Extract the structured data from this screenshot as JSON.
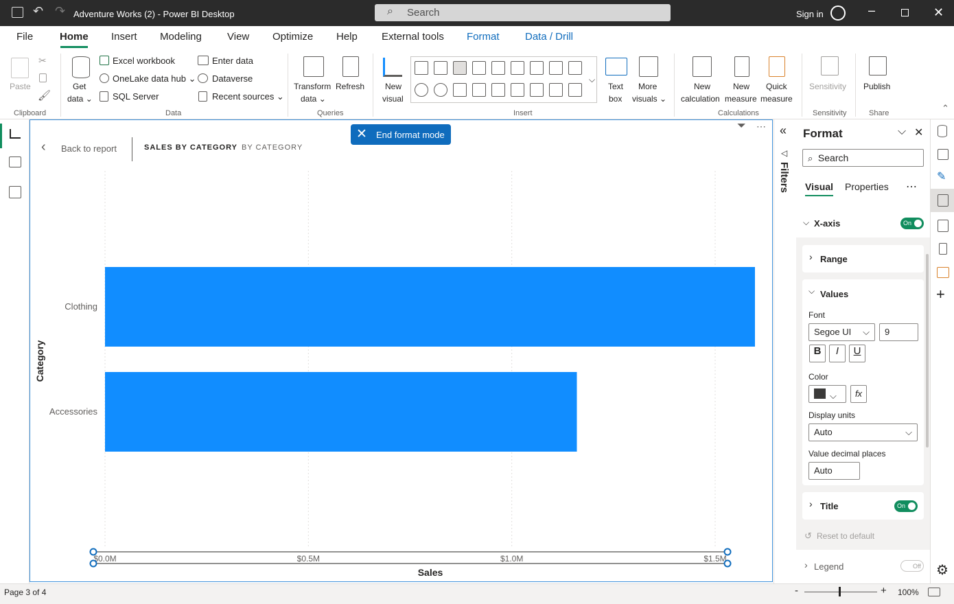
{
  "titlebar": {
    "title": "Adventure Works (2) - Power BI Desktop",
    "search": "Search",
    "signin": "Sign in"
  },
  "menu": [
    "File",
    "Home",
    "Insert",
    "Modeling",
    "View",
    "Optimize",
    "Help",
    "External tools",
    "Format",
    "Data / Drill"
  ],
  "ribbon": {
    "paste": "Paste",
    "clipboard": "Clipboard",
    "get_data_1": "Get",
    "get_data_2": "data ⌄",
    "excel": "Excel workbook",
    "onelake": "OneLake data hub ⌄",
    "sql": "SQL Server",
    "enter_data": "Enter data",
    "dataverse": "Dataverse",
    "recent": "Recent sources ⌄",
    "data_group": "Data",
    "transform_1": "Transform",
    "transform_2": "data ⌄",
    "refresh": "Refresh",
    "queries": "Queries",
    "new_visual_1": "New",
    "new_visual_2": "visual",
    "text_box_1": "Text",
    "text_box_2": "box",
    "more_visuals_1": "More",
    "more_visuals_2": "visuals ⌄",
    "insert_group": "Insert",
    "new_calc_1": "New",
    "new_calc_2": "calculation",
    "new_measure_1": "New",
    "new_measure_2": "measure",
    "quick_measure_1": "Quick",
    "quick_measure_2": "measure",
    "calculations": "Calculations",
    "sensitivity": "Sensitivity",
    "sensitivity_group": "Sensitivity",
    "publish": "Publish",
    "share": "Share"
  },
  "canvas": {
    "end_format": "End format mode",
    "back": "Back to report",
    "crumb1": "SALES BY CATEGORY",
    "crumb2": "BY CATEGORY"
  },
  "chart_data": {
    "type": "bar",
    "orientation": "horizontal",
    "categories": [
      "Clothing",
      "Accessories"
    ],
    "values": [
      1.6,
      1.16
    ],
    "xlabel": "Sales",
    "ylabel": "Category",
    "xlim": [
      0,
      1.5
    ],
    "xticks": [
      "$0.0M",
      "$0.5M",
      "$1.0M",
      "$1.5M"
    ],
    "bar_color": "#118dff",
    "grid": true
  },
  "filters": {
    "label": "Filters"
  },
  "format_pane": {
    "title": "Format",
    "search": "Search",
    "tab_visual": "Visual",
    "tab_properties": "Properties",
    "xaxis": "X-axis",
    "on": "On",
    "off": "Off",
    "range": "Range",
    "values": "Values",
    "font_label": "Font",
    "font_value": "Segoe UI",
    "font_size": "9",
    "bold": "B",
    "italic": "I",
    "underline": "U",
    "color_label": "Color",
    "fx": "fx",
    "display_units_label": "Display units",
    "display_units_value": "Auto",
    "decimal_label": "Value decimal places",
    "decimal_value": "Auto",
    "title_section": "Title",
    "reset": "Reset to default",
    "legend": "Legend"
  },
  "status": {
    "page": "Page 3 of 4",
    "zoom": "100%"
  },
  "colors": {
    "accent": "#118d5e",
    "bar": "#118dff",
    "selection": "#3c8fd9",
    "button": "#0f6cbd"
  }
}
